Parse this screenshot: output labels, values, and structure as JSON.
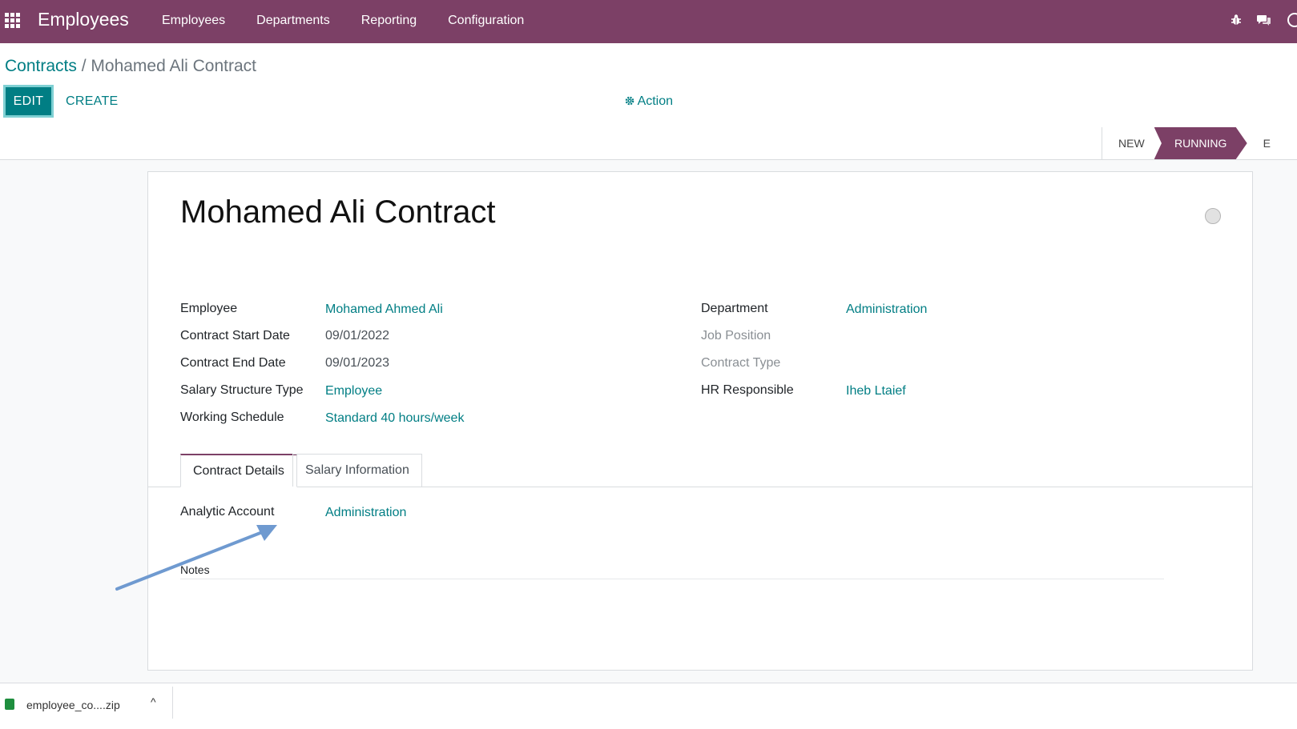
{
  "navbar": {
    "app_name": "Employees",
    "menu": [
      "Employees",
      "Departments",
      "Reporting",
      "Configuration"
    ],
    "icons": [
      "apps-grid-icon",
      "bug-icon",
      "chat-icon",
      "clock-icon"
    ]
  },
  "breadcrumb": {
    "parent": "Contracts",
    "separator": " / ",
    "current": "Mohamed Ali Contract"
  },
  "buttons": {
    "edit": "EDIT",
    "create": "CREATE",
    "action": "Action"
  },
  "statusbar": {
    "stages": [
      "NEW",
      "RUNNING",
      "E"
    ],
    "active": "RUNNING"
  },
  "form": {
    "title": "Mohamed Ali Contract",
    "left_fields": [
      {
        "label": "Employee",
        "value": "Mohamed Ahmed Ali"
      },
      {
        "label": "Contract Start Date",
        "value": "09/01/2022"
      },
      {
        "label": "Contract End Date",
        "value": "09/01/2023"
      },
      {
        "label": "Salary Structure Type",
        "value": "Employee"
      },
      {
        "label": "Working Schedule",
        "value": "Standard 40 hours/week"
      }
    ],
    "right_fields": [
      {
        "label": "Department",
        "value": "Administration"
      },
      {
        "label": "Job Position",
        "value": ""
      },
      {
        "label": "Contract Type",
        "value": ""
      },
      {
        "label": "HR Responsible",
        "value": "Iheb Ltaief"
      }
    ],
    "tabs": [
      "Contract Details",
      "Salary Information"
    ],
    "active_tab": "Contract Details",
    "analytic_account": {
      "label": "Analytic Account",
      "value": "Administration"
    },
    "notes_label": "Notes"
  },
  "download": {
    "filename": "employee_co....zip",
    "chevron": "^"
  },
  "colors": {
    "primary": "#7c4066",
    "teal": "#017e84",
    "arrow": "#6f9ad0"
  }
}
